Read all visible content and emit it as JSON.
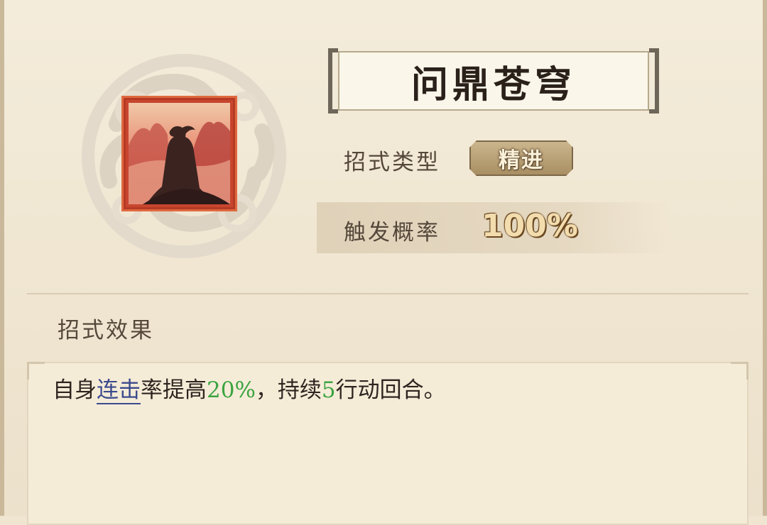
{
  "skill": {
    "name": "问鼎苍穹",
    "type_label": "招式类型",
    "type_value": "精进",
    "prob_label": "触发概率",
    "prob_value": "100%"
  },
  "effect": {
    "heading": "招式效果",
    "seg1": "自身",
    "keyword": "连击",
    "seg2": "率提高",
    "value1": "20%",
    "seg3": "，持续",
    "value2": "5",
    "seg4": "行动回合。"
  },
  "icons": {
    "emblem": "cloud-emblem-icon",
    "skill": "skill-portrait-icon"
  },
  "colors": {
    "keyword": "#3b4a8c",
    "number": "#3aa340",
    "icon_border": "#c8452e"
  }
}
